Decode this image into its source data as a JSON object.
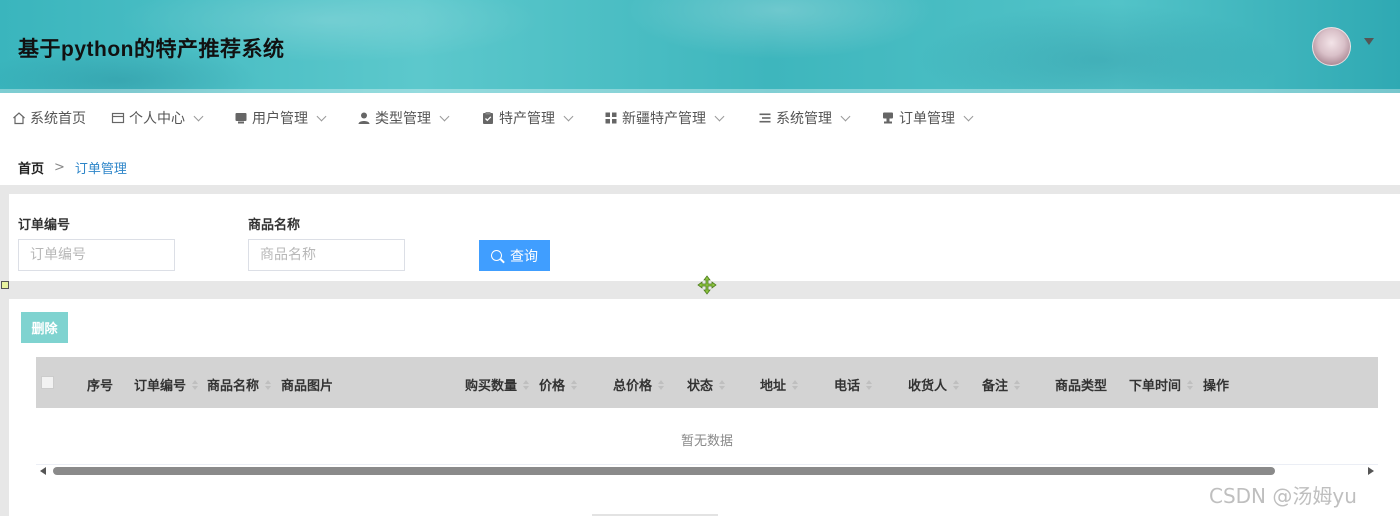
{
  "header": {
    "title": "基于python的特产推荐系统",
    "avatar_icon": "user-avatar",
    "menu_caret_icon": "caret-down-icon"
  },
  "nav": {
    "items": [
      {
        "label": "系统首页",
        "icon": "home-icon",
        "has_submenu": false
      },
      {
        "label": "个人中心",
        "icon": "wallet-icon",
        "has_submenu": true
      },
      {
        "label": "用户管理",
        "icon": "user-card-icon",
        "has_submenu": true
      },
      {
        "label": "类型管理",
        "icon": "person-icon",
        "has_submenu": true
      },
      {
        "label": "特产管理",
        "icon": "clipboard-icon",
        "has_submenu": true
      },
      {
        "label": "新疆特产管理",
        "icon": "grid-icon",
        "has_submenu": true
      },
      {
        "label": "系统管理",
        "icon": "list-icon",
        "has_submenu": true
      },
      {
        "label": "订单管理",
        "icon": "stamp-icon",
        "has_submenu": true
      }
    ]
  },
  "breadcrumb": {
    "home": "首页",
    "separator": ">",
    "current": "订单管理"
  },
  "search": {
    "order_no_label": "订单编号",
    "order_no_placeholder": "订单编号",
    "order_no_value": "",
    "product_name_label": "商品名称",
    "product_name_placeholder": "商品名称",
    "product_name_value": "",
    "query_button": "查询"
  },
  "table": {
    "delete_button": "删除",
    "columns": [
      {
        "label": "序号",
        "sortable": false
      },
      {
        "label": "订单编号",
        "sortable": true
      },
      {
        "label": "商品名称",
        "sortable": true
      },
      {
        "label": "商品图片",
        "sortable": false
      },
      {
        "label": "购买数量",
        "sortable": true
      },
      {
        "label": "价格",
        "sortable": true
      },
      {
        "label": "总价格",
        "sortable": true
      },
      {
        "label": "状态",
        "sortable": true
      },
      {
        "label": "地址",
        "sortable": true
      },
      {
        "label": "电话",
        "sortable": true
      },
      {
        "label": "收货人",
        "sortable": true
      },
      {
        "label": "备注",
        "sortable": true
      },
      {
        "label": "商品类型",
        "sortable": false
      },
      {
        "label": "下单时间",
        "sortable": true
      },
      {
        "label": "操作",
        "sortable": false
      }
    ],
    "rows": [],
    "empty_text": "暂无数据"
  },
  "watermark": "CSDN @汤姆yu",
  "colors": {
    "primary": "#409eff",
    "delete_button": "#7fd3d0",
    "breadcrumb_active": "#2e86c9",
    "header_teal": "#3eb6bd",
    "table_header_bg": "#d3d3d3"
  }
}
